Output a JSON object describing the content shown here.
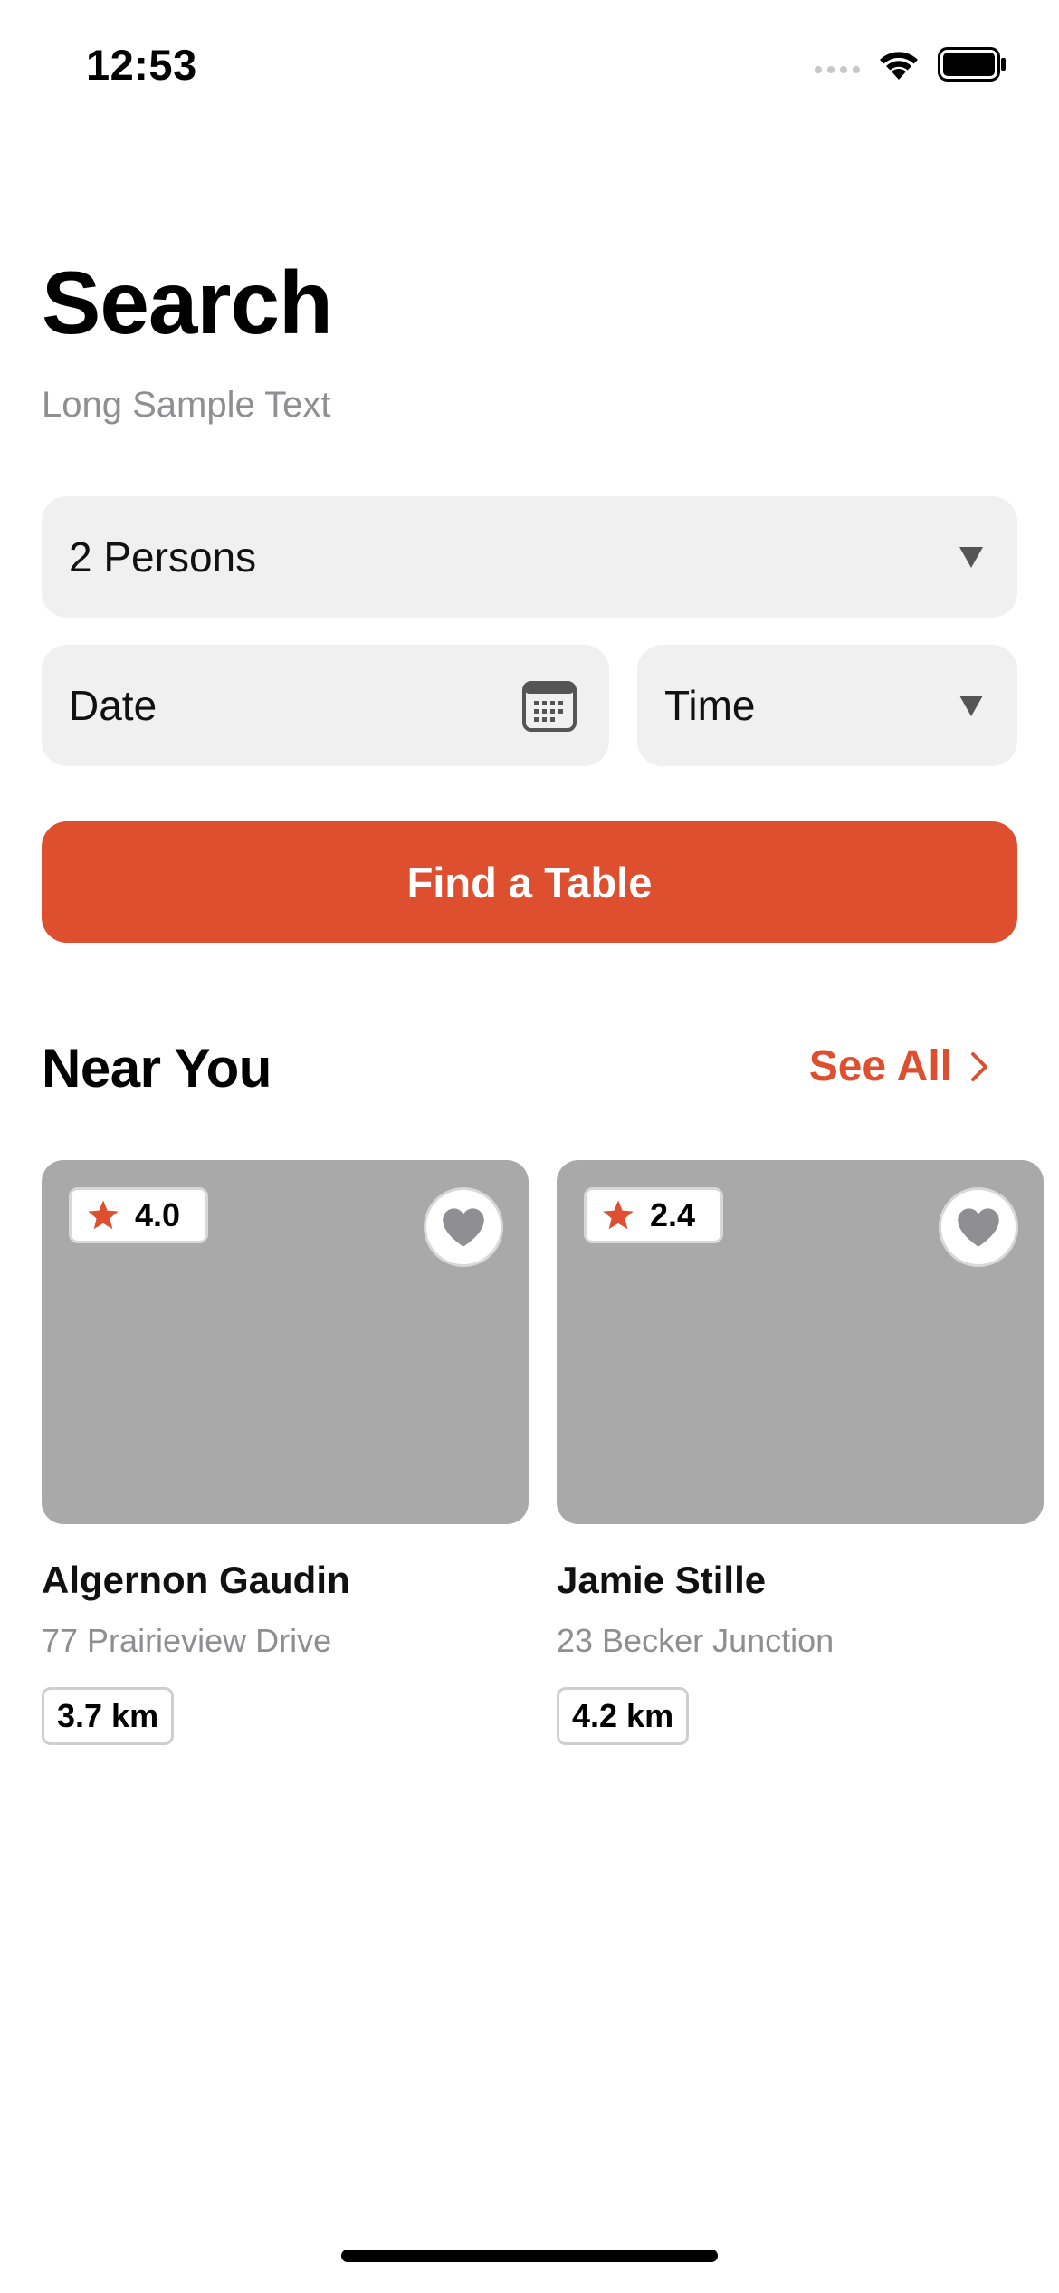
{
  "status_bar": {
    "time": "12:53",
    "icons": [
      "signal-icon",
      "wifi-icon",
      "battery-icon"
    ]
  },
  "header": {
    "title": "Search",
    "subtitle": "Long Sample Text"
  },
  "form": {
    "persons_value": "2 Persons",
    "date_placeholder": "Date",
    "time_placeholder": "Time",
    "submit_label": "Find a Table"
  },
  "near_you": {
    "title": "Near You",
    "see_all_label": "See All",
    "restaurants": [
      {
        "rating": "4.0",
        "name": "Algernon Gaudin",
        "address": "77 Prairieview Drive",
        "distance": "3.7 km"
      },
      {
        "rating": "2.4",
        "name": "Jamie Stille",
        "address": "23 Becker Junction",
        "distance": "4.2 km"
      }
    ]
  },
  "colors": {
    "accent": "#dd4f2f",
    "field_background": "#f0f0f0",
    "image_placeholder": "#a9a9a9",
    "secondary_text": "#8e8e93"
  }
}
